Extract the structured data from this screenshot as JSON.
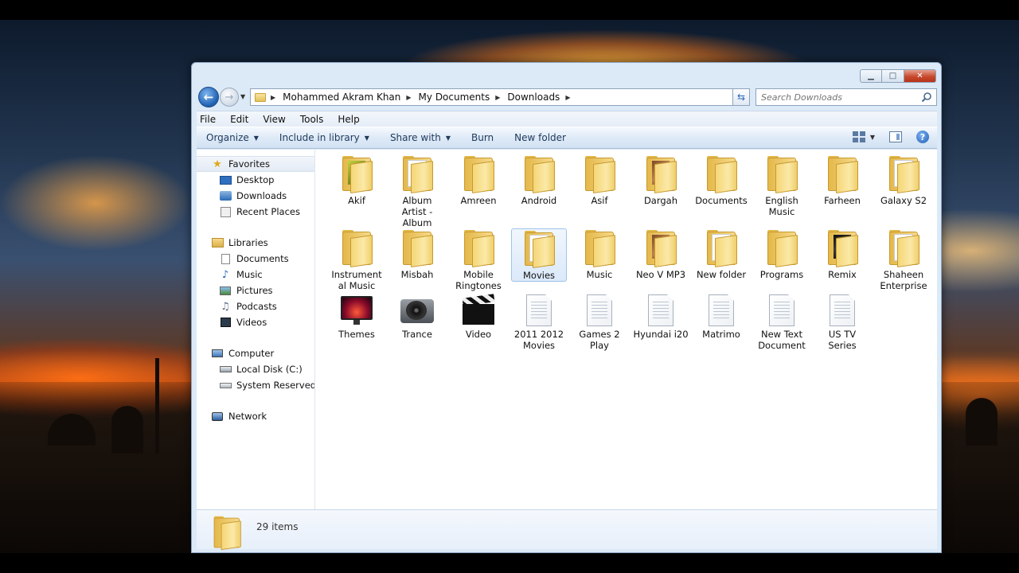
{
  "window": {
    "minimize_glyph": "▁",
    "maximize_glyph": "□",
    "close_glyph": "✕"
  },
  "nav": {
    "back_glyph": "←",
    "forward_glyph": "→",
    "breadcrumb": [
      "Mohammed Akram Khan",
      "My Documents",
      "Downloads"
    ],
    "search_placeholder": "Search Downloads"
  },
  "menu": [
    "File",
    "Edit",
    "View",
    "Tools",
    "Help"
  ],
  "commands": {
    "organize": "Organize",
    "include_in_library": "Include in library",
    "share_with": "Share with",
    "burn": "Burn",
    "new_folder": "New folder"
  },
  "sidebar": {
    "favorites": {
      "label": "Favorites",
      "items": [
        "Desktop",
        "Downloads",
        "Recent Places"
      ]
    },
    "libraries": {
      "label": "Libraries",
      "items": [
        "Documents",
        "Music",
        "Pictures",
        "Podcasts",
        "Videos"
      ]
    },
    "computer": {
      "label": "Computer",
      "items": [
        "Local Disk (C:)",
        "System Reserved (F:)"
      ]
    },
    "network": {
      "label": "Network"
    }
  },
  "files": [
    {
      "name": "Akif",
      "type": "folder-media"
    },
    {
      "name": "Album Artist - Album",
      "type": "folder-paper"
    },
    {
      "name": "Amreen",
      "type": "folder"
    },
    {
      "name": "Android",
      "type": "folder"
    },
    {
      "name": "Asif",
      "type": "folder"
    },
    {
      "name": "Dargah",
      "type": "folder-photo"
    },
    {
      "name": "Documents",
      "type": "folder"
    },
    {
      "name": "English Music",
      "type": "folder"
    },
    {
      "name": "Farheen",
      "type": "folder"
    },
    {
      "name": "Galaxy S2",
      "type": "folder-paper"
    },
    {
      "name": "Instrumental Music",
      "type": "folder"
    },
    {
      "name": "Misbah",
      "type": "folder"
    },
    {
      "name": "Mobile Ringtones",
      "type": "folder"
    },
    {
      "name": "Movies",
      "type": "folder-paper",
      "selected": true
    },
    {
      "name": "Music",
      "type": "folder"
    },
    {
      "name": "Neo V MP3",
      "type": "folder-photo"
    },
    {
      "name": "New folder",
      "type": "folder-paper"
    },
    {
      "name": "Programs",
      "type": "folder"
    },
    {
      "name": "Remix",
      "type": "folder-dark"
    },
    {
      "name": "Shaheen Enterprise",
      "type": "folder-paper"
    },
    {
      "name": "Themes",
      "type": "app-themes"
    },
    {
      "name": "Trance",
      "type": "app-trance"
    },
    {
      "name": "Video",
      "type": "app-video"
    },
    {
      "name": "2011 2012 Movies",
      "type": "doc"
    },
    {
      "name": "Games 2 Play",
      "type": "doc"
    },
    {
      "name": "Hyundai i20",
      "type": "doc"
    },
    {
      "name": "Matrimo",
      "type": "doc"
    },
    {
      "name": "New Text Document",
      "type": "doc"
    },
    {
      "name": "US TV Series",
      "type": "doc"
    }
  ],
  "status": {
    "item_count": "29 items"
  }
}
